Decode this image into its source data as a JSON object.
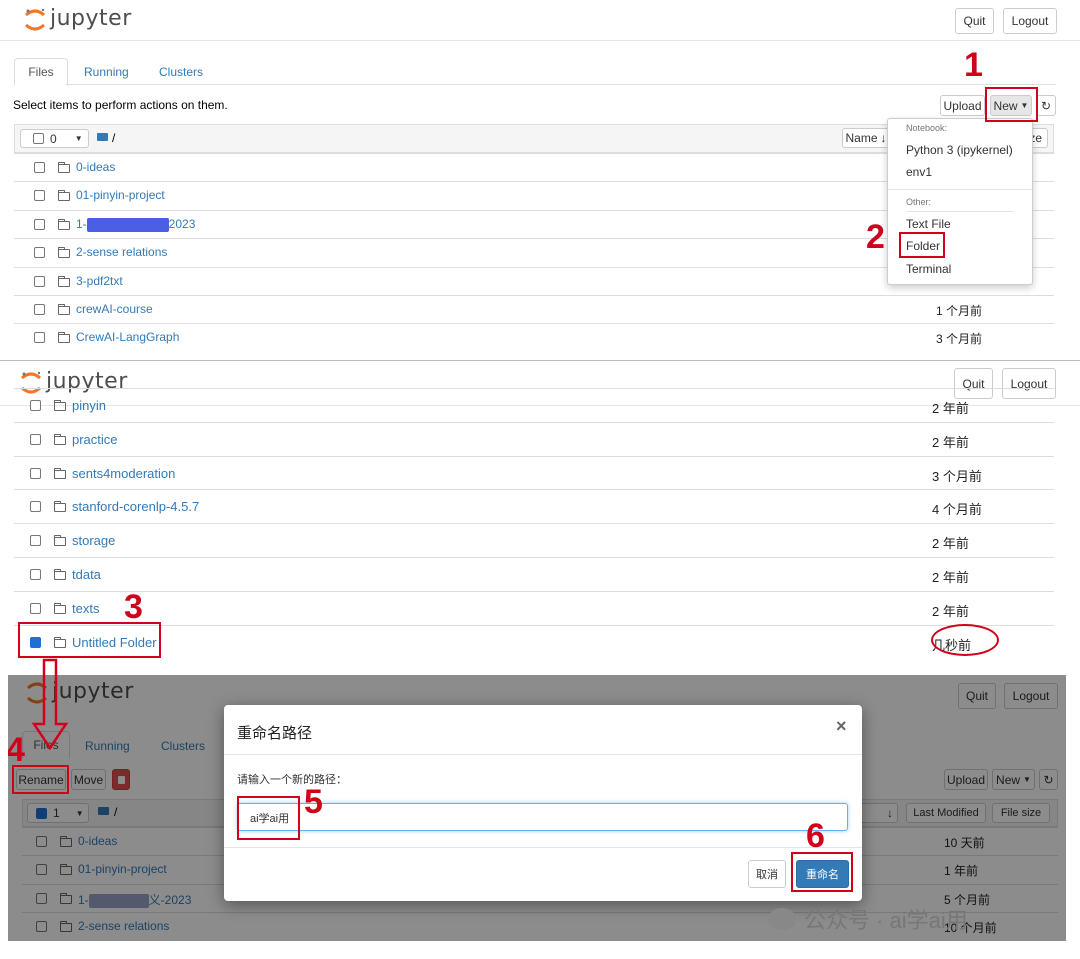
{
  "app": {
    "logo_text": "jupyter"
  },
  "header": {
    "quit_label": "Quit",
    "logout_label": "Logout"
  },
  "tabs": {
    "files": "Files",
    "running": "Running",
    "clusters": "Clusters"
  },
  "toolbar": {
    "select_hint": "Select items to perform actions on them.",
    "upload_label": "Upload",
    "new_label": "New",
    "selected_count_1": "0",
    "selected_count_3": "1",
    "breadcrumb": "/",
    "rename_label": "Rename",
    "move_label": "Move"
  },
  "columns": {
    "name": "Name",
    "last_modified": "Last Modified",
    "file_size": "File size",
    "size_partial": "ze"
  },
  "new_menu": {
    "notebook_header": "Notebook:",
    "python3": "Python 3 (ipykernel)",
    "env1": "env1",
    "other_header": "Other:",
    "text_file": "Text File",
    "folder": "Folder",
    "terminal": "Terminal"
  },
  "panel1_rows": [
    {
      "name": "0-ideas",
      "date": ""
    },
    {
      "name": "01-pinyin-project",
      "date": ""
    },
    {
      "name_prefix": "1-",
      "name_suffix": "2023",
      "date": ""
    },
    {
      "name": "2-sense relations",
      "date": ""
    },
    {
      "name": "3-pdf2txt",
      "date": ""
    },
    {
      "name": "crewAI-course",
      "date": "1 个月前"
    },
    {
      "name": "CrewAI-LangGraph",
      "date": "3 个月前"
    }
  ],
  "panel2_rows": [
    {
      "name": "pinyin",
      "date": "2 年前"
    },
    {
      "name": "practice",
      "date": "2 年前"
    },
    {
      "name": "sents4moderation",
      "date": "3 个月前"
    },
    {
      "name": "stanford-corenlp-4.5.7",
      "date": "4 个月前"
    },
    {
      "name": "storage",
      "date": "2 年前"
    },
    {
      "name": "tdata",
      "date": "2 年前"
    },
    {
      "name": "texts",
      "date": "2 年前"
    },
    {
      "name": "Untitled Folder",
      "date": "几秒前"
    }
  ],
  "panel3_rows": [
    {
      "name": "0-ideas",
      "date": "10 天前"
    },
    {
      "name": "01-pinyin-project",
      "date": "1 年前"
    },
    {
      "name_prefix": "1-",
      "name_suffix": "义-2023",
      "date": "5 个月前"
    },
    {
      "name": "2-sense relations",
      "date": "10 个月前"
    }
  ],
  "dialog": {
    "title": "重命名路径",
    "close": "×",
    "prompt": "请输入一个新的路径：",
    "input_value": "ai学ai用",
    "cancel_label": "取消",
    "confirm_label": "重命名"
  },
  "steps": [
    "1",
    "2",
    "3",
    "4",
    "5",
    "6"
  ],
  "watermark": "公众号 · ai学ai用",
  "colors": {
    "accent_red": "#d0021b",
    "link": "#337ab7",
    "primary": "#337ab7",
    "logo_orange": "#f37726"
  }
}
